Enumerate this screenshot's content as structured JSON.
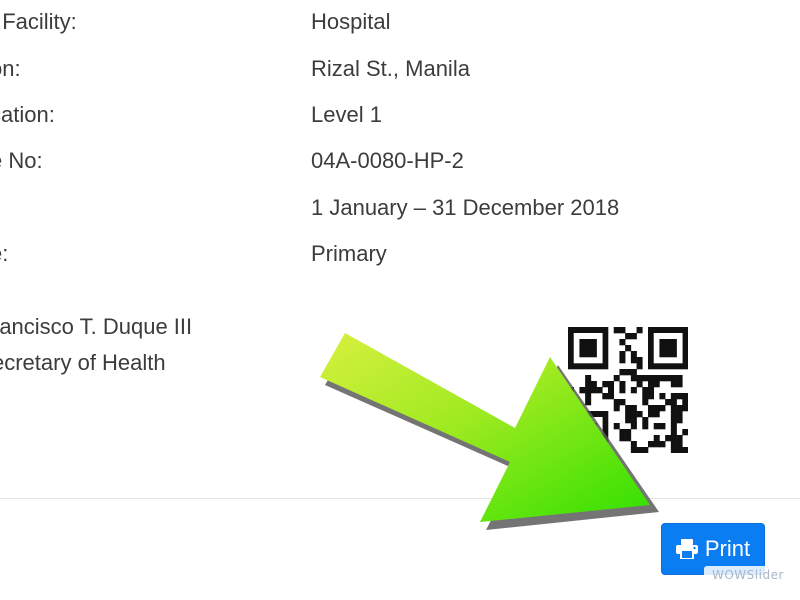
{
  "details": [
    {
      "label": "f Facility:",
      "value": "Hospital"
    },
    {
      "label": "on:",
      "value": "Rizal St., Manila"
    },
    {
      "label": "cation:",
      "value": "Level 1"
    },
    {
      "label": "e No:",
      "value": "04A-0080-HP-2"
    },
    {
      "label": ":",
      "value": "1 January – 31 December 2018"
    },
    {
      "label": "e:",
      "value": "Primary"
    }
  ],
  "signatory": {
    "name": "rancisco T. Duque III",
    "title": "ecretary of Health"
  },
  "actions": {
    "print_label": "Print",
    "print_icon": "printer-icon",
    "accent": "#0b7df3"
  },
  "annotation": {
    "arrow_color": "#7fe510"
  },
  "watermark": "WOWSlider"
}
